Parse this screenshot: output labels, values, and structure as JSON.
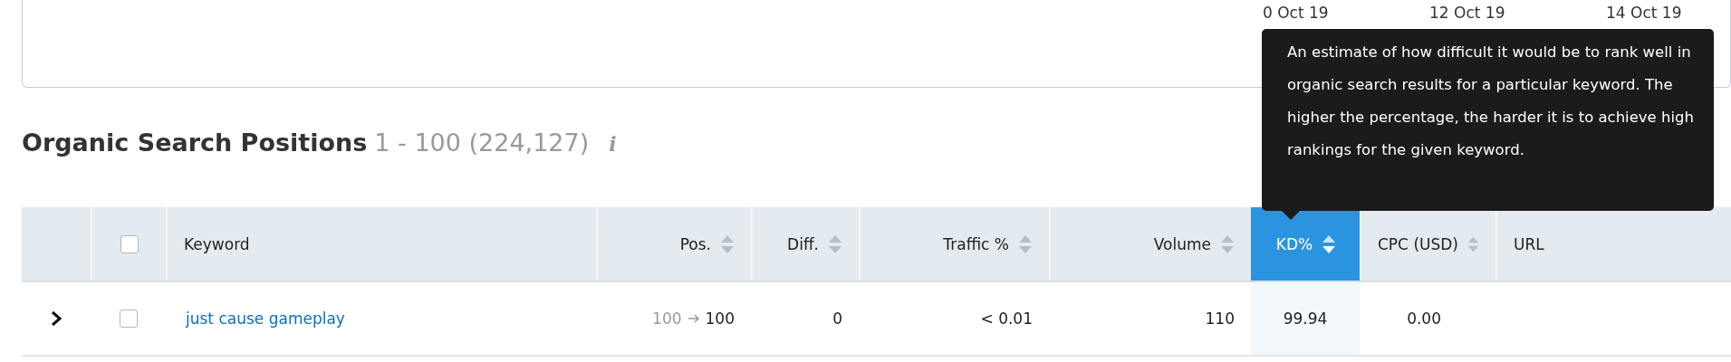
{
  "chart": {
    "x_labels": [
      "0 Oct 19",
      "12 Oct 19",
      "14 Oct 19"
    ]
  },
  "heading": {
    "title": "Organic Search Positions",
    "range": "1 - 100 (224,127)",
    "info": "i"
  },
  "tooltip": {
    "text": "An estimate of how difficult it would be to rank well in organic search results for a particular keyword. The higher the percentage, the harder it is to achieve high rankings for the given keyword."
  },
  "table": {
    "select_all": {
      "checked": false
    },
    "columns": [
      {
        "label": "Keyword",
        "sortable": false,
        "selected": false
      },
      {
        "label": "Pos.",
        "sortable": true,
        "selected": false
      },
      {
        "label": "Diff.",
        "sortable": true,
        "selected": false
      },
      {
        "label": "Traffic %",
        "sortable": true,
        "selected": false
      },
      {
        "label": "Volume",
        "sortable": true,
        "selected": false
      },
      {
        "label": "KD%",
        "sortable": true,
        "selected": true
      },
      {
        "label": "CPC (USD)",
        "sortable": true,
        "selected": false
      },
      {
        "label": "URL",
        "sortable": false,
        "selected": false
      }
    ],
    "rows": [
      {
        "expanded": false,
        "checked": false,
        "keyword": "just cause gameplay",
        "pos_from": "100",
        "pos_to": "100",
        "diff": "0",
        "traffic": "< 0.01",
        "volume": "110",
        "kd": "99.94",
        "cpc": "0.00"
      }
    ]
  }
}
